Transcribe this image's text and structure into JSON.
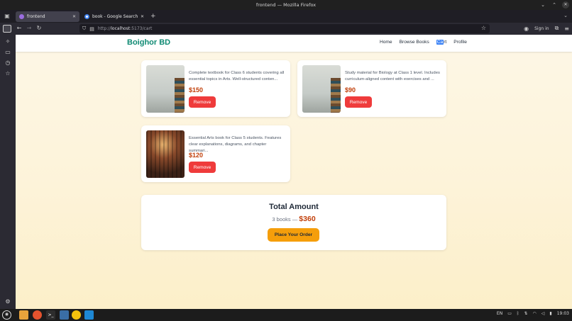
{
  "window": {
    "title": "frontend — Mozilla Firefox"
  },
  "tabs": [
    {
      "label": "frontend",
      "active": true
    },
    {
      "label": "book - Google Search",
      "active": false
    }
  ],
  "toolbar": {
    "url_prefix": "http://",
    "url_host": "localhost",
    "url_path": ":5173/cart",
    "signin_label": "Sign in"
  },
  "site": {
    "brand": "Boighor BD",
    "nav": {
      "home": "Home",
      "browse": "Browse Books",
      "cart_hl": "Ca",
      "cart_rest": "rt",
      "profile": "Profile"
    }
  },
  "cart": {
    "items": [
      {
        "description": "Complete textbook for Class 6 students covering all essential topics in Arts. Well-structured conten...",
        "price": "$150",
        "remove_label": "Remove",
        "image": "book-stack-photo"
      },
      {
        "description": "Study material for Biology at Class 1 level. Includes curriculum-aligned content with exercises and ...",
        "price": "$90",
        "remove_label": "Remove",
        "image": "book-stack-photo"
      },
      {
        "description": "Essential Arts book for Class 5 students. Features clear explanations, diagrams, and chapter summari...",
        "price": "$120",
        "remove_label": "Remove",
        "image": "library-shelves-photo"
      }
    ],
    "total_title": "Total Amount",
    "books_count": "3 books —",
    "total_amount": "$360",
    "order_label": "Place Your Order"
  },
  "taskbar": {
    "lang": "EN",
    "time": "19:03"
  },
  "colors": {
    "brand": "#0f8a73",
    "price": "#c2410c",
    "remove": "#ef3b3b",
    "order": "#f59e0b"
  }
}
